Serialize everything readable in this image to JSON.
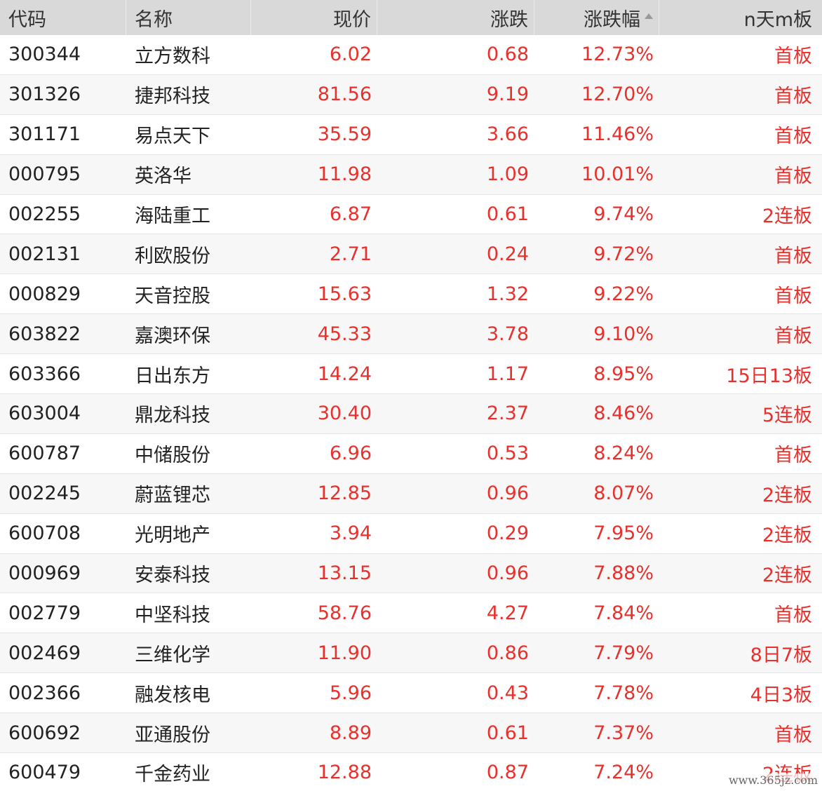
{
  "columns": {
    "code": "代码",
    "name": "名称",
    "price": "现价",
    "change": "涨跌",
    "pct": "涨跌幅",
    "board": "n天m板"
  },
  "sort_icon": "sort-ascending-icon",
  "colors": {
    "up": "#e8302c",
    "header_bg": "#d9d9d9"
  },
  "rows": [
    {
      "code": "300344",
      "name": "立方数科",
      "price": "6.02",
      "change": "0.68",
      "pct": "12.73%",
      "board": "首板"
    },
    {
      "code": "301326",
      "name": "捷邦科技",
      "price": "81.56",
      "change": "9.19",
      "pct": "12.70%",
      "board": "首板"
    },
    {
      "code": "301171",
      "name": "易点天下",
      "price": "35.59",
      "change": "3.66",
      "pct": "11.46%",
      "board": "首板"
    },
    {
      "code": "000795",
      "name": "英洛华",
      "price": "11.98",
      "change": "1.09",
      "pct": "10.01%",
      "board": "首板"
    },
    {
      "code": "002255",
      "name": "海陆重工",
      "price": "6.87",
      "change": "0.61",
      "pct": "9.74%",
      "board": "2连板"
    },
    {
      "code": "002131",
      "name": "利欧股份",
      "price": "2.71",
      "change": "0.24",
      "pct": "9.72%",
      "board": "首板"
    },
    {
      "code": "000829",
      "name": "天音控股",
      "price": "15.63",
      "change": "1.32",
      "pct": "9.22%",
      "board": "首板"
    },
    {
      "code": "603822",
      "name": "嘉澳环保",
      "price": "45.33",
      "change": "3.78",
      "pct": "9.10%",
      "board": "首板"
    },
    {
      "code": "603366",
      "name": "日出东方",
      "price": "14.24",
      "change": "1.17",
      "pct": "8.95%",
      "board": "15日13板"
    },
    {
      "code": "603004",
      "name": "鼎龙科技",
      "price": "30.40",
      "change": "2.37",
      "pct": "8.46%",
      "board": "5连板"
    },
    {
      "code": "600787",
      "name": "中储股份",
      "price": "6.96",
      "change": "0.53",
      "pct": "8.24%",
      "board": "首板"
    },
    {
      "code": "002245",
      "name": "蔚蓝锂芯",
      "price": "12.85",
      "change": "0.96",
      "pct": "8.07%",
      "board": "2连板"
    },
    {
      "code": "600708",
      "name": "光明地产",
      "price": "3.94",
      "change": "0.29",
      "pct": "7.95%",
      "board": "2连板"
    },
    {
      "code": "000969",
      "name": "安泰科技",
      "price": "13.15",
      "change": "0.96",
      "pct": "7.88%",
      "board": "2连板"
    },
    {
      "code": "002779",
      "name": "中坚科技",
      "price": "58.76",
      "change": "4.27",
      "pct": "7.84%",
      "board": "首板"
    },
    {
      "code": "002469",
      "name": "三维化学",
      "price": "11.90",
      "change": "0.86",
      "pct": "7.79%",
      "board": "8日7板"
    },
    {
      "code": "002366",
      "name": "融发核电",
      "price": "5.96",
      "change": "0.43",
      "pct": "7.78%",
      "board": "4日3板"
    },
    {
      "code": "600692",
      "name": "亚通股份",
      "price": "8.89",
      "change": "0.61",
      "pct": "7.37%",
      "board": "首板"
    },
    {
      "code": "600479",
      "name": "千金药业",
      "price": "12.88",
      "change": "0.87",
      "pct": "7.24%",
      "board": "2连板"
    }
  ],
  "watermark": "www.365jz.com"
}
